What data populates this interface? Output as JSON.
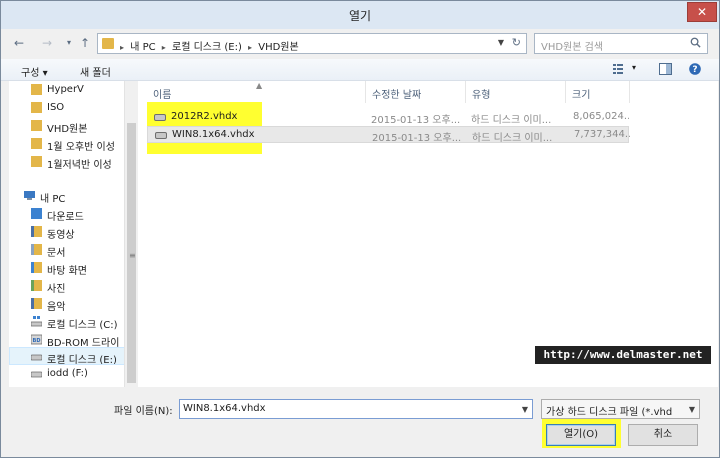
{
  "window": {
    "title": "열기",
    "close_glyph": "✕"
  },
  "nav": {
    "back_icon": "←",
    "forward_icon": "→",
    "recent_icon": "▾",
    "up_icon": "↑",
    "breadcrumbs": [
      "내 PC",
      "로컬 디스크 (E:)",
      "VHD원본"
    ],
    "search_placeholder": "VHD원본 검색"
  },
  "toolbar": {
    "organize": "구성 ▾",
    "new_folder": "새 폴더"
  },
  "sidebar": {
    "items": [
      {
        "label": "HyperV",
        "icon": "folder-icon"
      },
      {
        "label": "ISO",
        "icon": "folder-icon"
      },
      {
        "label": "VHD원본",
        "icon": "folder-icon"
      },
      {
        "label": "1월 오후반 이성",
        "icon": "folder-icon"
      },
      {
        "label": "1월저녁반 이성",
        "icon": "folder-icon"
      },
      {
        "label": "내 PC",
        "icon": "computer-icon"
      },
      {
        "label": "다운로드",
        "icon": "downloads-icon"
      },
      {
        "label": "동영상",
        "icon": "videos-icon"
      },
      {
        "label": "문서",
        "icon": "documents-icon"
      },
      {
        "label": "바탕 화면",
        "icon": "desktop-icon"
      },
      {
        "label": "사진",
        "icon": "pictures-icon"
      },
      {
        "label": "음악",
        "icon": "music-icon"
      },
      {
        "label": "로컬 디스크 (C:)",
        "icon": "drive-icon"
      },
      {
        "label": "BD-ROM 드라이",
        "icon": "optical-drive-icon"
      },
      {
        "label": "로컬 디스크 (E:)",
        "icon": "drive-icon"
      },
      {
        "label": "iodd (F:)",
        "icon": "drive-icon"
      }
    ]
  },
  "files": {
    "columns": [
      "이름",
      "수정한 날짜",
      "유형",
      "크기"
    ],
    "rows": [
      {
        "name": "2012R2.vhdx",
        "date": "2015-01-13 오후...",
        "type": "하드 디스크 이미...",
        "size": "8,065,024..."
      },
      {
        "name": "WIN8.1x64.vhdx",
        "date": "2015-01-13 오후...",
        "type": "하드 디스크 이미...",
        "size": "7,737,344..."
      }
    ]
  },
  "watermark": "http://www.delmaster.net",
  "footer": {
    "filename_label": "파일 이름(N):",
    "filename_value": "WIN8.1x64.vhdx",
    "filetype_value": "가상 하드 디스크 파일   (*.vhd",
    "open_button": "열기(O)",
    "cancel_button": "취소"
  },
  "colors": {
    "highlight": "#ffff30",
    "folder": "#e3b649",
    "title_bar": "#dce7f3"
  }
}
